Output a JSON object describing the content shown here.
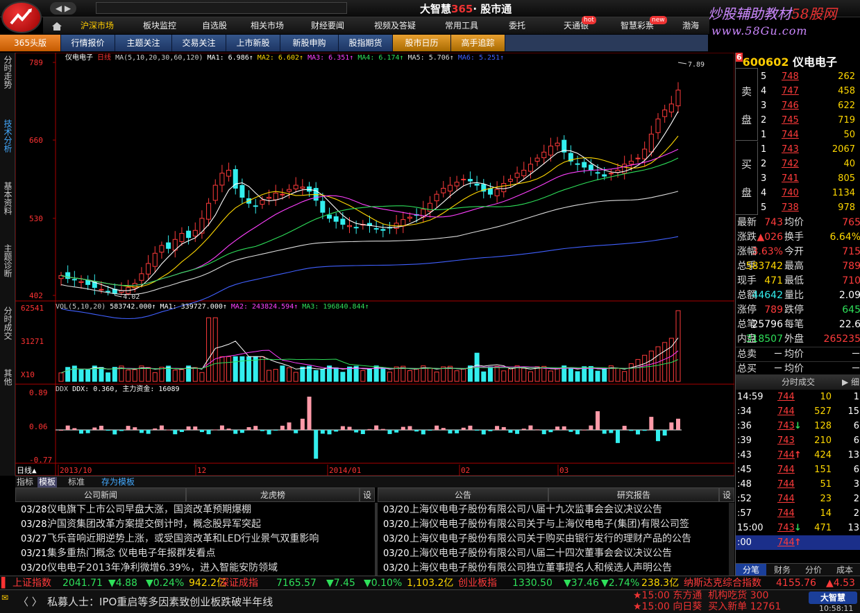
{
  "titlebar": {
    "app_name": "大智慧",
    "app_365": "365",
    "app_module": "· 股市通",
    "brand_name": "炒股辅助教材",
    "brand_site": "58股网",
    "brand_url": "www.58Gu.com",
    "nav_arrows": "◀ ▶"
  },
  "menu": [
    {
      "label": "沪深市场",
      "active": true
    },
    {
      "label": "板块监控"
    },
    {
      "label": "自选股"
    },
    {
      "label": "相关市场"
    },
    {
      "label": "财经要闻"
    },
    {
      "label": "视频及答疑"
    },
    {
      "label": "常用工具"
    },
    {
      "label": "委托"
    },
    {
      "label": "天通银",
      "badge": "hot"
    },
    {
      "label": "智慧彩票",
      "badge": "new"
    },
    {
      "label": "渤海"
    }
  ],
  "subnav": [
    {
      "label": "365头版",
      "style": "orange"
    },
    {
      "label": "行情报价"
    },
    {
      "label": "主题关注"
    },
    {
      "label": "交易关注"
    },
    {
      "label": "上市新股"
    },
    {
      "label": "新股申购"
    },
    {
      "label": "股指期货"
    },
    {
      "label": "股市日历",
      "style": "gold"
    },
    {
      "label": "高手追踪",
      "style": "gold"
    }
  ],
  "left_tabs": [
    {
      "label": "分时走势"
    },
    {
      "label": "技术分析",
      "active": true
    },
    {
      "label": "基本资料"
    },
    {
      "label": "主题诊断"
    },
    {
      "label": "分时成交"
    },
    {
      "label": "其他"
    }
  ],
  "main_chart": {
    "title": "仪电电子",
    "period": "日线",
    "ma_label": "MA(5,10,20,30,60,120)",
    "ma_values": [
      {
        "name": "MA1",
        "value": "6.986",
        "color": "#ffffff"
      },
      {
        "name": "MA2",
        "value": "6.602",
        "color": "#ffd800"
      },
      {
        "name": "MA3",
        "value": "6.351",
        "color": "#ff40ff"
      },
      {
        "name": "MA4",
        "value": "6.174",
        "color": "#2ee05a"
      },
      {
        "name": "MA5",
        "value": "5.706",
        "color": "#dddddd"
      },
      {
        "name": "MA6",
        "value": "5.251",
        "color": "#4060ff"
      }
    ],
    "price_ticks": [
      "789",
      "660",
      "530",
      "402"
    ],
    "high_marker": "7.89",
    "low_marker": "4.02",
    "vol_label": "VOL(5,10,20)",
    "vol_value": "583742.000",
    "vol_ma": [
      {
        "name": "MA1",
        "value": "339727.000",
        "color": "#ffffff"
      },
      {
        "name": "MA2",
        "value": "243824.594",
        "color": "#ff40ff"
      },
      {
        "name": "MA3",
        "value": "196840.844",
        "color": "#2ee05a"
      }
    ],
    "vol_ticks": [
      "62541",
      "31271",
      "X10"
    ],
    "ddx_label": "DDX",
    "ddx_value": "DDX: 0.360",
    "ddx_fund": "主力资金: 16089",
    "ddx_ticks": [
      "0.89",
      "0.06",
      "-0.77"
    ],
    "date_ticks": [
      "2013/10",
      "12",
      "2014/01",
      "02",
      "03"
    ],
    "period_indicator": "日线▲"
  },
  "chart_data": {
    "type": "candlestick",
    "x_range": [
      "2013/10",
      "2014/03"
    ],
    "y_range": [
      4.02,
      7.89
    ],
    "last_close": 7.43,
    "series": [
      {
        "name": "MA1",
        "last": 6.986
      },
      {
        "name": "MA2",
        "last": 6.602
      },
      {
        "name": "MA3",
        "last": 6.351
      },
      {
        "name": "MA4",
        "last": 6.174
      },
      {
        "name": "MA5",
        "last": 5.706
      },
      {
        "name": "MA6",
        "last": 5.251
      }
    ],
    "closes": [
      4.35,
      4.3,
      4.28,
      4.25,
      4.2,
      4.15,
      4.12,
      4.08,
      4.05,
      4.1,
      4.15,
      4.22,
      4.38,
      4.55,
      4.72,
      4.85,
      4.8,
      4.95,
      5.05,
      4.98,
      5.1,
      5.3,
      5.55,
      5.85,
      6.05,
      6.1,
      5.8,
      5.65,
      5.55,
      5.5,
      5.6,
      5.65,
      5.72,
      5.7,
      5.78,
      5.85,
      5.82,
      5.75,
      5.6,
      5.4,
      5.3,
      5.25,
      5.2,
      5.18,
      5.15,
      5.2,
      5.18,
      5.12,
      5.1,
      5.14,
      5.22,
      5.28,
      5.32,
      5.35,
      5.45,
      5.55,
      5.7,
      5.8,
      5.85,
      5.9,
      5.95,
      5.92,
      5.85,
      5.75,
      5.7,
      5.78,
      5.88,
      5.95,
      6.05,
      6.1,
      6.2,
      6.3,
      6.4,
      6.5,
      6.55,
      6.4,
      6.25,
      6.2,
      6.15,
      6.1,
      6.05,
      6.0,
      6.05,
      6.1,
      6.2,
      6.25,
      6.3,
      6.45,
      6.7,
      6.95,
      7.1,
      7.2,
      7.43
    ]
  },
  "bottom_tabs": [
    "指标",
    "模板",
    "标准",
    "存为模板"
  ],
  "news": {
    "left_headers": [
      "公司新闻",
      "龙虎榜",
      "设"
    ],
    "right_headers": [
      "公告",
      "研究报告",
      "设"
    ],
    "left_items": [
      {
        "date": "03/28",
        "text": "仪电旗下上市公司早盘大涨，国资改革预期爆棚"
      },
      {
        "date": "03/28",
        "text": "沪国资集团改革方案提交倒计时，概念股异军突起"
      },
      {
        "date": "03/27",
        "text": "飞乐音响近期逆势上涨，或受国资改革和LED行业景气双重影响"
      },
      {
        "date": "03/21",
        "text": "集多重热门概念 仪电电子年报群发看点"
      },
      {
        "date": "03/20",
        "text": "仪电电子2013年净利微增6.39%，进入智能安防领域"
      }
    ],
    "right_items": [
      {
        "date": "03/20",
        "text": "上海仪电电子股份有限公司八届十九次监事会会议决议公告"
      },
      {
        "date": "03/20",
        "text": "上海仪电电子股份有限公司关于与上海仪电电子(集团)有限公司签"
      },
      {
        "date": "03/20",
        "text": "上海仪电电子股份有限公司关于购买由银行发行的理财产品的公告"
      },
      {
        "date": "03/20",
        "text": "上海仪电电子股份有限公司八届二十四次董事会会议决议公告"
      },
      {
        "date": "03/20",
        "text": "上海仪电电子股份有限公司独立董事提名人和候选人声明公告"
      }
    ]
  },
  "quote": {
    "code": "600602",
    "name": "仪电电子",
    "sell_label_1": "卖",
    "sell_label_2": "盘",
    "buy_label_1": "买",
    "buy_label_2": "盘",
    "asks": [
      {
        "level": "5",
        "price": "748",
        "vol": "262"
      },
      {
        "level": "4",
        "price": "747",
        "vol": "458"
      },
      {
        "level": "3",
        "price": "746",
        "vol": "622"
      },
      {
        "level": "2",
        "price": "745",
        "vol": "719"
      },
      {
        "level": "1",
        "price": "744",
        "vol": "50"
      }
    ],
    "bids": [
      {
        "level": "1",
        "price": "743",
        "vol": "2067"
      },
      {
        "level": "2",
        "price": "742",
        "vol": "40"
      },
      {
        "level": "3",
        "price": "741",
        "vol": "805"
      },
      {
        "level": "4",
        "price": "740",
        "vol": "1134"
      },
      {
        "level": "5",
        "price": "738",
        "vol": "978"
      }
    ],
    "stats": [
      {
        "l1": "最新",
        "v1": "743",
        "c1": "red",
        "l2": "均价",
        "v2": "765",
        "c2": "red"
      },
      {
        "l1": "涨跌",
        "v1": "▲026",
        "c1": "red",
        "l2": "换手",
        "v2": "6.64%",
        "c2": "yellow"
      },
      {
        "l1": "涨幅",
        "v1": "3.63%",
        "c1": "red",
        "l2": "今开",
        "v2": "715",
        "c2": "red"
      },
      {
        "l1": "总手",
        "v1": "583742",
        "c1": "yellow",
        "l2": "最高",
        "v2": "789",
        "c2": "red"
      },
      {
        "l1": "现手",
        "v1": "471",
        "c1": "yellow",
        "l2": "最低",
        "v2": "710",
        "c2": "red"
      },
      {
        "l1": "总额",
        "v1": "44642",
        "c1": "cyan",
        "l2": "量比",
        "v2": "2.09",
        "c2": "white"
      },
      {
        "l1": "涨停",
        "v1": "789",
        "c1": "red",
        "l2": "跌停",
        "v2": "645",
        "c2": "green"
      },
      {
        "l1": "总笔",
        "v1": "25796",
        "c1": "white",
        "l2": "每笔",
        "v2": "22.6",
        "c2": "white"
      },
      {
        "l1": "内盘",
        "v1": "318507",
        "c1": "green",
        "l2": "外盘",
        "v2": "265235",
        "c2": "red"
      },
      {
        "l1": "总卖",
        "v1": "－",
        "c1": "white",
        "l2": "均价",
        "v2": "－",
        "c2": "white"
      },
      {
        "l1": "总买",
        "v1": "－",
        "c1": "white",
        "l2": "均价",
        "v2": "－",
        "c2": "white"
      }
    ],
    "ticks_header": "分时成交",
    "ticks_more": "▶ 细",
    "ticks": [
      {
        "t": "14:59",
        "p": "744",
        "arr": "",
        "v": "10",
        "n": "1"
      },
      {
        "t": ":34",
        "p": "744",
        "arr": "",
        "v": "527",
        "n": "15"
      },
      {
        "t": ":36",
        "p": "743",
        "arr": "↓",
        "v": "128",
        "n": "6"
      },
      {
        "t": ":39",
        "p": "743",
        "arr": "",
        "v": "210",
        "n": "6"
      },
      {
        "t": ":43",
        "p": "744",
        "arr": "↑",
        "v": "424",
        "n": "13"
      },
      {
        "t": ":45",
        "p": "744",
        "arr": "",
        "v": "151",
        "n": "6"
      },
      {
        "t": ":48",
        "p": "744",
        "arr": "",
        "v": "51",
        "n": "3"
      },
      {
        "t": ":52",
        "p": "744",
        "arr": "",
        "v": "23",
        "n": "2"
      },
      {
        "t": ":57",
        "p": "744",
        "arr": "",
        "v": "14",
        "n": "2"
      },
      {
        "t": "15:00",
        "p": "743",
        "arr": "↓",
        "v": "471",
        "n": "13"
      },
      {
        "t": ":00",
        "p": "744",
        "arr": "↑",
        "v": "",
        "n": ""
      }
    ],
    "right_tabs": [
      "分笔",
      "财务",
      "分价",
      "成本"
    ]
  },
  "index_ticker": [
    {
      "text": "上证指数",
      "c": "red"
    },
    {
      "text": "2041.71",
      "c": "green"
    },
    {
      "text": "▼4.88",
      "c": "green"
    },
    {
      "text": "▼0.24%",
      "c": "green"
    },
    {
      "text": "942.2亿",
      "c": "yellow"
    },
    {
      "text": "深证成指",
      "c": "red"
    },
    {
      "text": "7165.57",
      "c": "green"
    },
    {
      "text": "▼7.45",
      "c": "green"
    },
    {
      "text": "▼0.10%",
      "c": "green"
    },
    {
      "text": "1,103.2亿",
      "c": "yellow"
    },
    {
      "text": "创业板指",
      "c": "red"
    },
    {
      "text": "1330.50",
      "c": "green"
    },
    {
      "text": "▼37.46",
      "c": "green"
    },
    {
      "text": "▼2.74%",
      "c": "green"
    },
    {
      "text": "238.3亿",
      "c": "yellow"
    },
    {
      "text": "纳斯达克综合指数",
      "c": "red"
    },
    {
      "text": "4155.76",
      "c": "red"
    },
    {
      "text": "▲4.53",
      "c": "red"
    }
  ],
  "status": {
    "scroll_message": "私募人士：IPO重启等多因素致创业板跌破半年线",
    "alert1_time": "★15:00",
    "alert1_stock": "东方通",
    "alert1_text": "机构吃货 300",
    "alert2_time": "★15:00",
    "alert2_stock": "向日葵",
    "alert2_text": "买入新单 12761",
    "logo": "大智慧",
    "clock": "10:58:11"
  }
}
